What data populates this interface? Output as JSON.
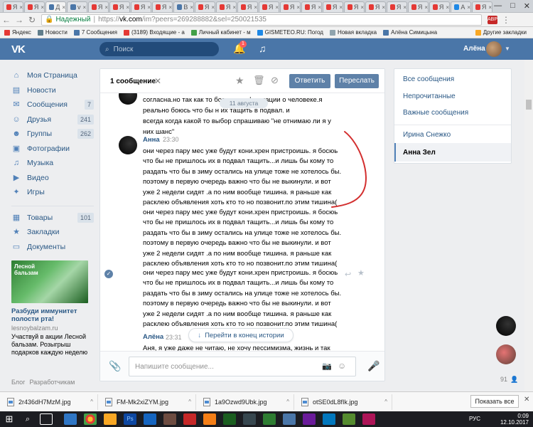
{
  "browser": {
    "tabs": [
      {
        "label": "Я",
        "color": "#e53935"
      },
      {
        "label": "Я",
        "color": "#e53935"
      },
      {
        "label": "Д",
        "color": "#4a76a8"
      },
      {
        "label": "v",
        "color": "#4a76a8"
      },
      {
        "label": "Я",
        "color": "#e53935"
      },
      {
        "label": "Я",
        "color": "#e53935"
      },
      {
        "label": "Я",
        "color": "#e53935"
      },
      {
        "label": "Я",
        "color": "#e53935"
      },
      {
        "label": "B",
        "color": "#4a76a8"
      },
      {
        "label": "Я",
        "color": "#e53935"
      },
      {
        "label": "Я",
        "color": "#e53935"
      },
      {
        "label": "Я",
        "color": "#e53935"
      },
      {
        "label": "Я",
        "color": "#e53935"
      },
      {
        "label": "Я",
        "color": "#e53935"
      },
      {
        "label": "Я",
        "color": "#e53935"
      },
      {
        "label": "Я",
        "color": "#e53935"
      },
      {
        "label": "Я",
        "color": "#e53935"
      },
      {
        "label": "Я",
        "color": "#e53935"
      },
      {
        "label": "Я",
        "color": "#e53935"
      },
      {
        "label": "Я",
        "color": "#e53935"
      },
      {
        "label": "Я",
        "color": "#e53935"
      },
      {
        "label": "A",
        "color": "#1e88e5"
      },
      {
        "label": "Я",
        "color": "#e53935"
      }
    ],
    "url_secure_label": "Надежный",
    "url_scheme": "https://",
    "url_host": "vk.com",
    "url_path": "/im?peers=269288882&sel=250021535",
    "bookmarks": [
      {
        "label": "Яндекс",
        "color": "#e53935"
      },
      {
        "label": "Новости",
        "color": "#607d8b"
      },
      {
        "label": "7 Сообщения",
        "color": "#4a76a8"
      },
      {
        "label": "(3189) Входящие - a",
        "color": "#e53935"
      },
      {
        "label": "Личный кабинет - м",
        "color": "#43a047"
      },
      {
        "label": "GISMETEO.RU: Погод",
        "color": "#1e88e5"
      },
      {
        "label": "Новая вкладка",
        "color": "#90a4ae"
      },
      {
        "label": "Алёна Симицына",
        "color": "#4a76a8"
      }
    ],
    "other_bookmarks": "Другие закладки"
  },
  "vk": {
    "logo": "VK",
    "search_placeholder": "Поиск",
    "notif_count": "1",
    "user_name": "Алёна"
  },
  "leftmenu": {
    "items": [
      {
        "label": "Моя Страница",
        "icon": "home-icon",
        "glyph": "⌂",
        "count": ""
      },
      {
        "label": "Новости",
        "icon": "news-icon",
        "glyph": "▤",
        "count": ""
      },
      {
        "label": "Сообщения",
        "icon": "messages-icon",
        "glyph": "✉",
        "count": "7"
      },
      {
        "label": "Друзья",
        "icon": "friends-icon",
        "glyph": "☺",
        "count": "241"
      },
      {
        "label": "Группы",
        "icon": "groups-icon",
        "glyph": "☻",
        "count": "262"
      },
      {
        "label": "Фотографии",
        "icon": "photos-icon",
        "glyph": "▣",
        "count": ""
      },
      {
        "label": "Музыка",
        "icon": "music-icon",
        "glyph": "♫",
        "count": ""
      },
      {
        "label": "Видео",
        "icon": "video-icon",
        "glyph": "▶",
        "count": ""
      },
      {
        "label": "Игры",
        "icon": "games-icon",
        "glyph": "✦",
        "count": ""
      }
    ],
    "items2": [
      {
        "label": "Товары",
        "icon": "market-icon",
        "glyph": "▦",
        "count": "101"
      },
      {
        "label": "Закладки",
        "icon": "bookmarks-icon",
        "glyph": "★",
        "count": ""
      },
      {
        "label": "Документы",
        "icon": "documents-icon",
        "glyph": "▭",
        "count": ""
      }
    ],
    "ad_image_text": "Лесной бальзам",
    "ad_title": "Разбуди иммунитет полости рта!",
    "ad_url": "lesnoybalzam.ru",
    "ad_text": "Участвуй в акции Лесной бальзам. Розыгрыш подарков каждую неделю",
    "footer": [
      "Блог",
      "Разработчикам"
    ]
  },
  "chat": {
    "title": "1 сообщение",
    "reply": "Ответить",
    "forward": "Переслать",
    "date_chip": "11 августа",
    "top_lines": [
      "согласна.но так как то больше информации о человеке.я",
      "реально боюсь что бы н                  их тащить в подвал. и",
      "всегда когда какой то выбор спрашиваю \"не отнимаю ли я у",
      "них шанс\""
    ],
    "author1": "Анна",
    "time1": "23:30",
    "messages": [
      [
        "они через пару мес уже будут кони.хрен пристроишь. я босюь",
        "что бы не пришлось их в подвал тащить...и лишь бы кому то",
        "раздать что бы в зиму остались на улице тоже не хотелось бы.",
        "поэтому в первую очередь важно что бы не выкинули. и вот",
        "уже 2 недели сидят .а по ним вообще тишина. я раньше как",
        "расклею объявления хоть кто то но позвонит.по этим тишина("
      ],
      [
        "они через пару мес уже будут кони.хрен пристроишь. я босюь",
        "что бы не пришлось их в подвал тащить...и лишь бы кому то",
        "раздать что бы в зиму остались на улице тоже не хотелось бы.",
        "поэтому в первую очередь важно что бы не выкинули. и вот",
        "уже 2 недели сидят .а по ним вообще тишина. я раньше как",
        "расклею объявления хоть кто то но позвонит.по этим тишина("
      ],
      [
        "они через пару мес уже будут кони.хрен пристроишь. я босюь",
        "что бы не пришлось их в подвал тащить...и лишь бы кому то",
        "раздать что бы в зиму остались на улице тоже не хотелось бы.",
        "поэтому в первую очередь важно что бы не выкинули. и вот",
        "уже 2 недели сидят .а по ним вообще тишина. я раньше как",
        "расклею объявления хоть кто то но позвонит.по этим тишина("
      ]
    ],
    "author2": "Алёна",
    "time2": "23:31",
    "last_line": "Аня, я уже даже не читаю, не хочу пессимизма, жизнь и так",
    "goto_end": "Перейти в конец истории",
    "input_placeholder": "Напишите сообщение..."
  },
  "rightpanel": {
    "all": "Все сообщения",
    "unread": "Непрочитанные",
    "important": "Важные сообщения",
    "peer1": "Ирина Снежко",
    "peer2": "Анна Зел"
  },
  "online_count": "91",
  "downloads": [
    "2r436dH7MzM.jpg",
    "FM-Mk2xiZYM.jpg",
    "1a9Ozwd9Ubk.jpg",
    "otSE0dL8fIk.jpg"
  ],
  "show_all": "Показать все",
  "clock": {
    "time": "0:09",
    "date": "12.10.2017",
    "lang": "РУС"
  },
  "annotation_color": "#d32f2f"
}
